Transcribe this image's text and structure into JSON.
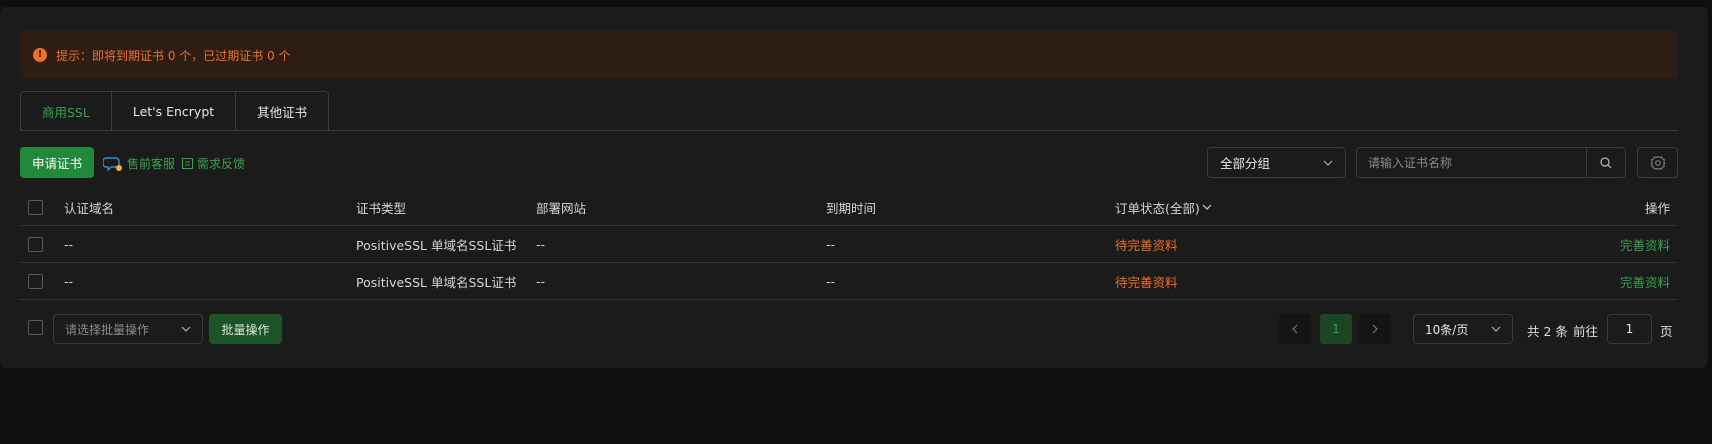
{
  "alert": {
    "text": "提示：即将到期证书 0 个，已过期证书 0 个"
  },
  "tabs": [
    {
      "label": "商用SSL",
      "active": true
    },
    {
      "label": "Let's Encrypt",
      "active": false
    },
    {
      "label": "其他证书",
      "active": false
    }
  ],
  "toolbar": {
    "apply_label": "申请证书",
    "presale_label": "售前客服",
    "feedback_label": "需求反馈",
    "group_value": "全部分组",
    "search_placeholder": "请输入证书名称"
  },
  "table": {
    "headers": [
      "认证域名",
      "证书类型",
      "部署网站",
      "到期时间",
      "订单状态(全部)",
      "操作"
    ],
    "rows": [
      {
        "domain": "--",
        "type": "PositiveSSL 单域名SSL证书",
        "site": "--",
        "expire": "--",
        "status": "待完善资料",
        "action": "完善资料"
      },
      {
        "domain": "--",
        "type": "PositiveSSL 单域名SSL证书",
        "site": "--",
        "expire": "--",
        "status": "待完善资料",
        "action": "完善资料"
      }
    ]
  },
  "footer": {
    "batch_placeholder": "请选择批量操作",
    "batch_button": "批量操作",
    "current_page": "1",
    "page_size": "10条/页",
    "total": "共 2 条",
    "goto_label": "前往",
    "goto_value": "1",
    "page_suffix": "页"
  },
  "colors": {
    "accent": "#20893a",
    "warning": "#f0702a",
    "background": "#1b1b1b"
  }
}
